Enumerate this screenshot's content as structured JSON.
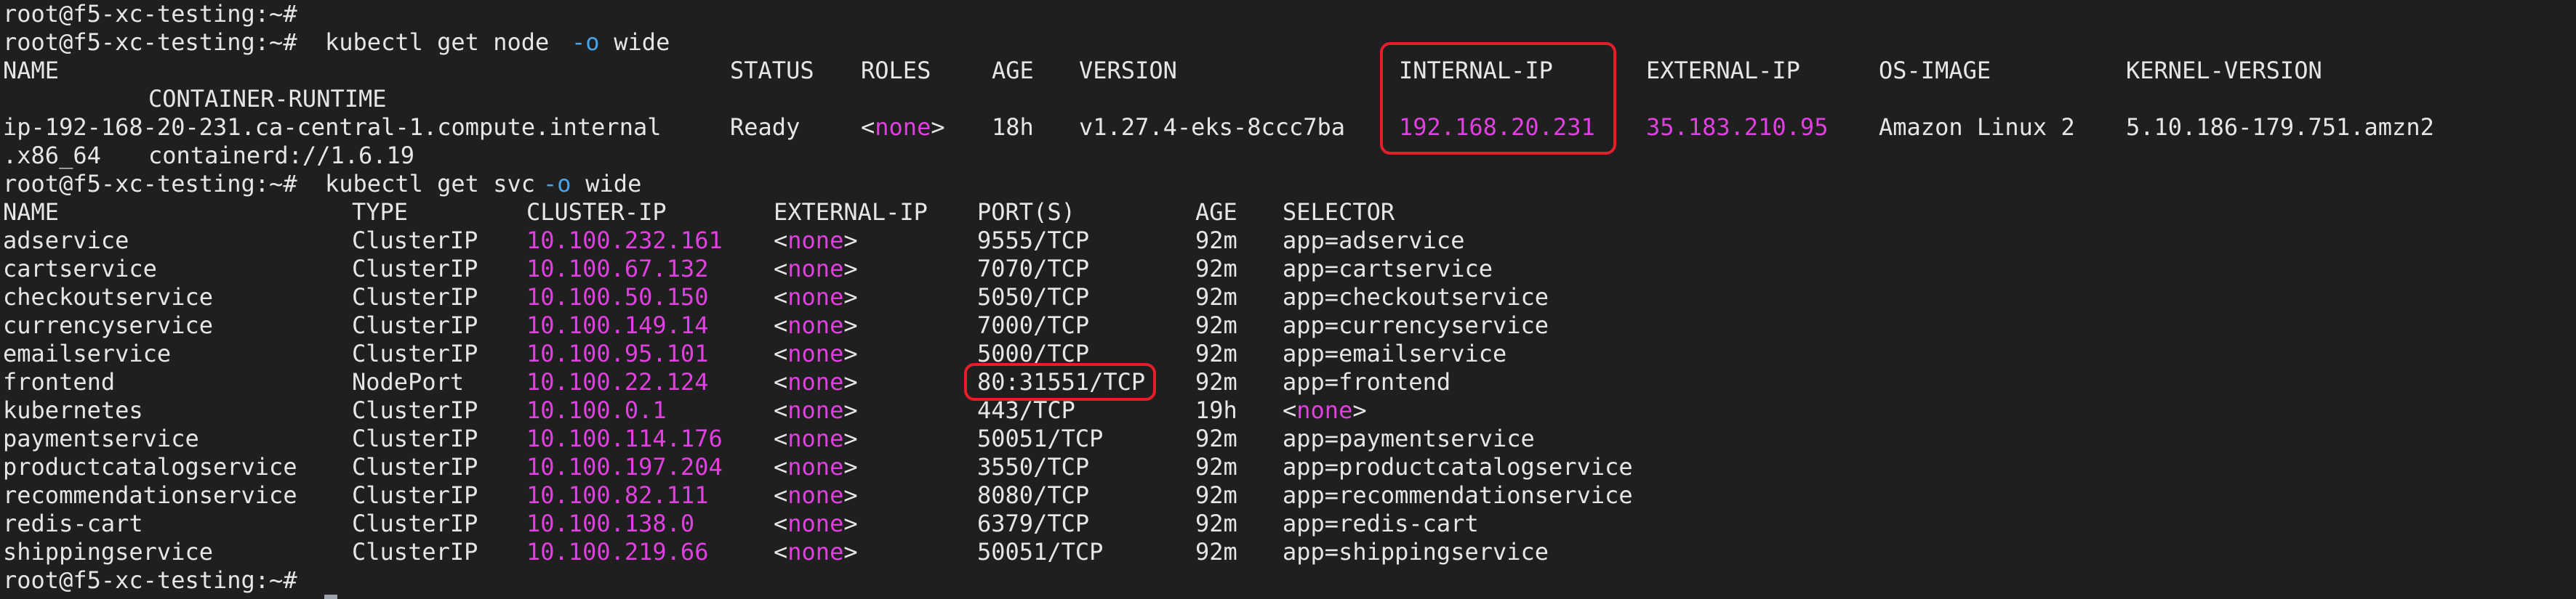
{
  "terminal": {
    "prompt": "root@f5-xc-testing:~#",
    "colors": {
      "background": "#1f1f1f",
      "text": "#e6e6e6",
      "ip_highlight": "#e040e0",
      "flag": "#4aa3e6",
      "callout": "#e51f2a"
    },
    "cmd_nodes": {
      "prefix": "kubectl get node ",
      "flag": "-o",
      "suffix": " wide"
    },
    "cmd_svc": {
      "prefix": "kubectl get svc ",
      "flag": "-o",
      "suffix": " wide"
    },
    "node_headers": [
      "NAME",
      "STATUS",
      "ROLES",
      "AGE",
      "VERSION",
      "INTERNAL-IP",
      "EXTERNAL-IP",
      "OS-IMAGE",
      "KERNEL-VERSION",
      "CONTAINER-RUNTIME"
    ],
    "node": {
      "name": "ip-192-168-20-231.ca-central-1.compute.internal",
      "status": "Ready",
      "roles": "<none>",
      "age": "18h",
      "version": "v1.27.4-eks-8ccc7ba",
      "internal_ip": "192.168.20.231",
      "external_ip": "35.183.210.95",
      "os_image": "Amazon Linux 2",
      "kernel_part1": "5.10.186-179.751.amzn2",
      "kernel_part2": ".x86_64",
      "container_runtime": "containerd://1.6.19"
    },
    "svc_headers": [
      "NAME",
      "TYPE",
      "CLUSTER-IP",
      "EXTERNAL-IP",
      "PORT(S)",
      "AGE",
      "SELECTOR"
    ],
    "services": [
      {
        "name": "adservice",
        "type": "ClusterIP",
        "cluster_ip": "10.100.232.161",
        "external_ip": "<none>",
        "ports": "9555/TCP",
        "age": "92m",
        "selector": "app=adservice"
      },
      {
        "name": "cartservice",
        "type": "ClusterIP",
        "cluster_ip": "10.100.67.132",
        "external_ip": "<none>",
        "ports": "7070/TCP",
        "age": "92m",
        "selector": "app=cartservice"
      },
      {
        "name": "checkoutservice",
        "type": "ClusterIP",
        "cluster_ip": "10.100.50.150",
        "external_ip": "<none>",
        "ports": "5050/TCP",
        "age": "92m",
        "selector": "app=checkoutservice"
      },
      {
        "name": "currencyservice",
        "type": "ClusterIP",
        "cluster_ip": "10.100.149.14",
        "external_ip": "<none>",
        "ports": "7000/TCP",
        "age": "92m",
        "selector": "app=currencyservice"
      },
      {
        "name": "emailservice",
        "type": "ClusterIP",
        "cluster_ip": "10.100.95.101",
        "external_ip": "<none>",
        "ports": "5000/TCP",
        "age": "92m",
        "selector": "app=emailservice"
      },
      {
        "name": "frontend",
        "type": "NodePort",
        "cluster_ip": "10.100.22.124",
        "external_ip": "<none>",
        "ports": "80:31551/TCP",
        "age": "92m",
        "selector": "app=frontend"
      },
      {
        "name": "kubernetes",
        "type": "ClusterIP",
        "cluster_ip": "10.100.0.1",
        "external_ip": "<none>",
        "ports": "443/TCP",
        "age": "19h",
        "selector": "<none>"
      },
      {
        "name": "paymentservice",
        "type": "ClusterIP",
        "cluster_ip": "10.100.114.176",
        "external_ip": "<none>",
        "ports": "50051/TCP",
        "age": "92m",
        "selector": "app=paymentservice"
      },
      {
        "name": "productcatalogservice",
        "type": "ClusterIP",
        "cluster_ip": "10.100.197.204",
        "external_ip": "<none>",
        "ports": "3550/TCP",
        "age": "92m",
        "selector": "app=productcatalogservice"
      },
      {
        "name": "recommendationservice",
        "type": "ClusterIP",
        "cluster_ip": "10.100.82.111",
        "external_ip": "<none>",
        "ports": "8080/TCP",
        "age": "92m",
        "selector": "app=recommendationservice"
      },
      {
        "name": "redis-cart",
        "type": "ClusterIP",
        "cluster_ip": "10.100.138.0",
        "external_ip": "<none>",
        "ports": "6379/TCP",
        "age": "92m",
        "selector": "app=redis-cart"
      },
      {
        "name": "shippingservice",
        "type": "ClusterIP",
        "cluster_ip": "10.100.219.66",
        "external_ip": "<none>",
        "ports": "50051/TCP",
        "age": "92m",
        "selector": "app=shippingservice"
      }
    ]
  }
}
